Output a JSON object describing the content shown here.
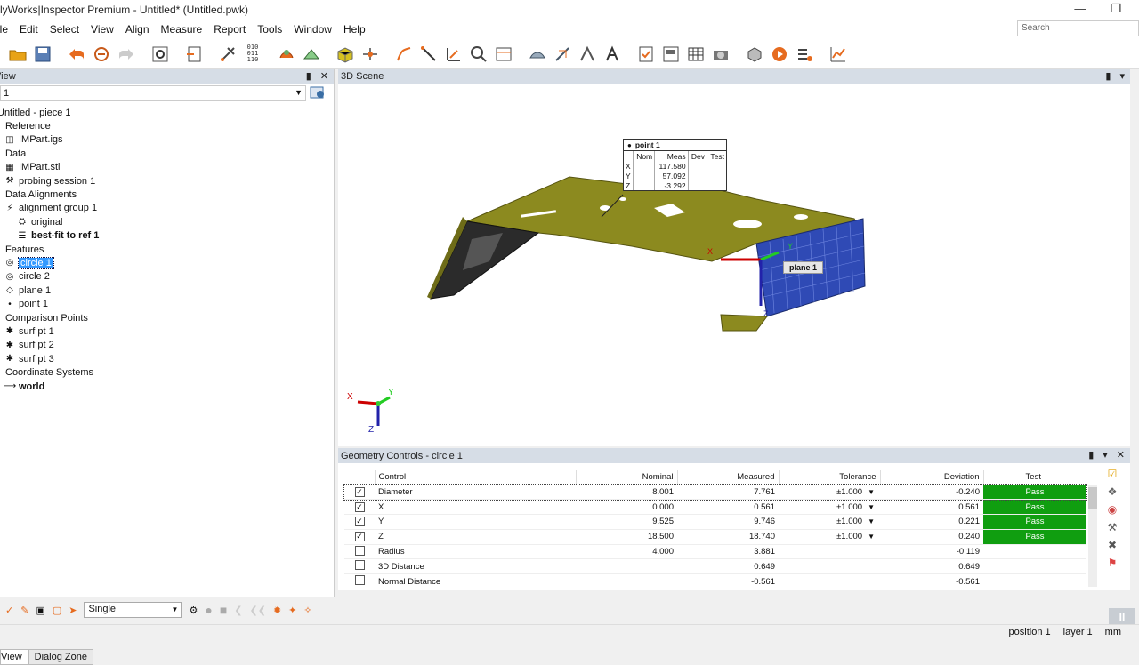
{
  "window": {
    "title": "lyWorks|Inspector Premium - Untitled* (Untitled.pwk)"
  },
  "menu": [
    "File",
    "Edit",
    "Select",
    "View",
    "Align",
    "Measure",
    "Report",
    "Tools",
    "Window",
    "Help"
  ],
  "search": {
    "placeholder": "Search"
  },
  "left_panel": {
    "title": "View",
    "combo_value": "1",
    "tree": [
      {
        "label": "Untitled - piece 1",
        "icon": "",
        "indent": 0
      },
      {
        "label": "Reference",
        "icon": "folder-icon",
        "indent": 1
      },
      {
        "label": "IMPart.igs",
        "icon": "cad-file-icon",
        "indent": 2
      },
      {
        "label": "Data",
        "icon": "folder-icon",
        "indent": 1
      },
      {
        "label": "IMPart.stl",
        "icon": "mesh-file-icon",
        "indent": 2
      },
      {
        "label": "probing session 1",
        "icon": "probe-icon",
        "indent": 2
      },
      {
        "label": "Data Alignments",
        "icon": "folder-icon",
        "indent": 1
      },
      {
        "label": "alignment group 1",
        "icon": "alignment-group-icon",
        "indent": 2
      },
      {
        "label": "original",
        "icon": "alignment-icon",
        "indent": 3
      },
      {
        "label": "best-fit to ref 1",
        "icon": "bestfit-icon",
        "indent": 3,
        "bold": true
      },
      {
        "label": "Features",
        "icon": "folder-icon",
        "indent": 1
      },
      {
        "label": "circle 1",
        "icon": "circle-feature-icon",
        "indent": 2,
        "selected": true
      },
      {
        "label": "circle 2",
        "icon": "circle-feature-icon",
        "indent": 2
      },
      {
        "label": "plane 1",
        "icon": "plane-feature-icon",
        "indent": 2
      },
      {
        "label": "point 1",
        "icon": "point-feature-icon",
        "indent": 2
      },
      {
        "label": "Comparison Points",
        "icon": "folder-icon",
        "indent": 1
      },
      {
        "label": "surf pt 1",
        "icon": "surface-point-icon",
        "indent": 2
      },
      {
        "label": "surf pt 2",
        "icon": "surface-point-icon",
        "indent": 2
      },
      {
        "label": "surf pt 3",
        "icon": "surface-point-icon",
        "indent": 2
      },
      {
        "label": "Coordinate Systems",
        "icon": "folder-icon",
        "indent": 1
      },
      {
        "label": "world",
        "icon": "coordinate-system-icon",
        "indent": 2,
        "bold": true
      }
    ],
    "tabs": [
      "View",
      "Dialog Zone"
    ]
  },
  "scene": {
    "title": "3D Scene",
    "point_label": {
      "title": "point 1",
      "headers": [
        "",
        "Nom",
        "Meas",
        "Dev",
        "Test"
      ],
      "rows": [
        [
          "X",
          "",
          "117.580",
          "",
          ""
        ],
        [
          "Y",
          "",
          "57.092",
          "",
          ""
        ],
        [
          "Z",
          "",
          "-3.292",
          "",
          ""
        ]
      ]
    },
    "plane_label": "plane 1",
    "axes": {
      "x": "X",
      "y": "Y",
      "z": "Z"
    }
  },
  "geometry_controls": {
    "title": "Geometry Controls - circle 1",
    "headers": [
      "Control",
      "Nominal",
      "Measured",
      "Tolerance",
      "Deviation",
      "Test"
    ],
    "rows": [
      {
        "checked": true,
        "control": "Diameter",
        "nominal": "8.001",
        "measured": "7.761",
        "tolerance": "±1.000",
        "deviation": "-0.240",
        "test": "Pass"
      },
      {
        "checked": true,
        "control": "X",
        "nominal": "0.000",
        "measured": "0.561",
        "tolerance": "±1.000",
        "deviation": "0.561",
        "test": "Pass"
      },
      {
        "checked": true,
        "control": "Y",
        "nominal": "9.525",
        "measured": "9.746",
        "tolerance": "±1.000",
        "deviation": "0.221",
        "test": "Pass"
      },
      {
        "checked": true,
        "control": "Z",
        "nominal": "18.500",
        "measured": "18.740",
        "tolerance": "±1.000",
        "deviation": "0.240",
        "test": "Pass"
      },
      {
        "checked": false,
        "control": "Radius",
        "nominal": "4.000",
        "measured": "3.881",
        "tolerance": "",
        "deviation": "-0.119",
        "test": ""
      },
      {
        "checked": false,
        "control": "3D Distance",
        "nominal": "",
        "measured": "0.649",
        "tolerance": "",
        "deviation": "0.649",
        "test": ""
      },
      {
        "checked": false,
        "control": "Normal Distance",
        "nominal": "",
        "measured": "-0.561",
        "tolerance": "",
        "deviation": "-0.561",
        "test": ""
      }
    ]
  },
  "bottom": {
    "mode": "Single"
  },
  "status": {
    "position": "position 1",
    "layer": "layer 1",
    "units": "mm"
  },
  "colors": {
    "pass": "#109e10",
    "selection": "#3399ff",
    "part": "#8c8a1f",
    "panel_header": "#d6dde6"
  }
}
